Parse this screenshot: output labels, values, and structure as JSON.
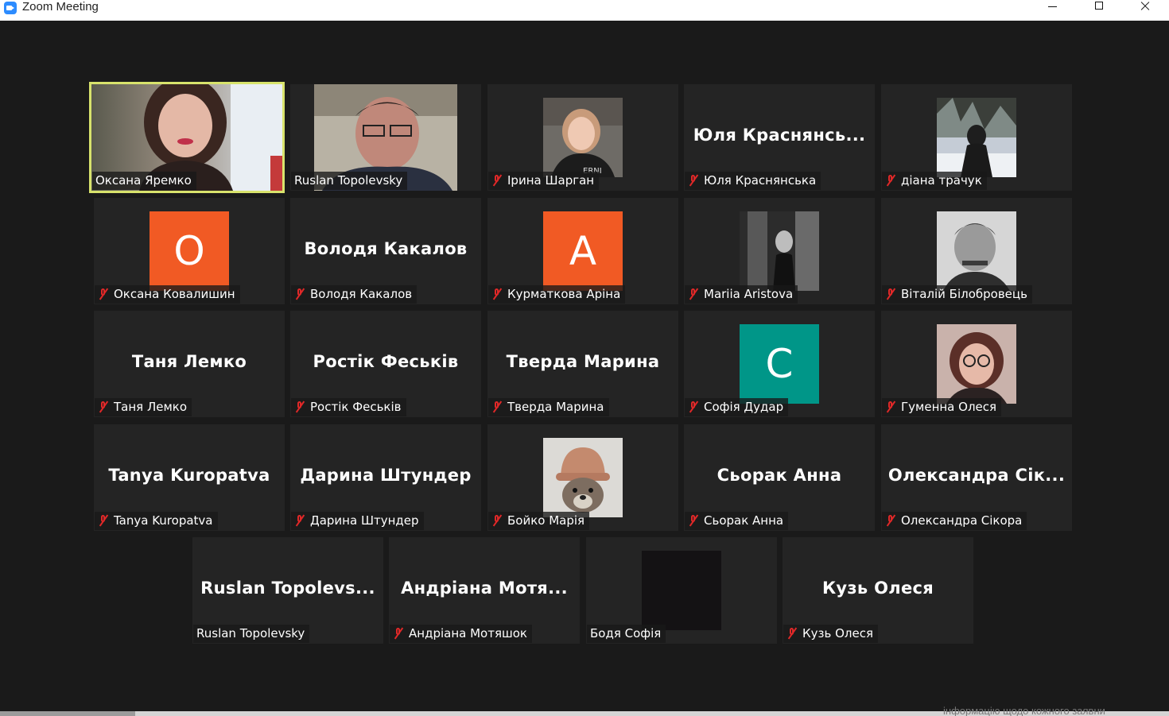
{
  "window": {
    "title": "Zoom Meeting",
    "controls": [
      "minimize",
      "maximize",
      "close"
    ]
  },
  "colors": {
    "active_speaker_border": "#d8e36c",
    "tile_bg": "#242424",
    "avatar_orange": "#f15a24",
    "avatar_teal": "#009688",
    "muted_icon": "#e02828"
  },
  "participants": [
    {
      "id": "p01",
      "label": "Оксана Яремко",
      "display": "video",
      "muted": false,
      "active": true
    },
    {
      "id": "p02",
      "label": "Ruslan Topolevsky",
      "display": "video",
      "muted": false
    },
    {
      "id": "p03",
      "label": "Ірина Шарган",
      "display": "photo",
      "muted": true
    },
    {
      "id": "p04",
      "label": "Юля Краснянська",
      "display": "name",
      "big": "Юля  Краснянсь...",
      "muted": true
    },
    {
      "id": "p05",
      "label": "діана трачук",
      "display": "photo",
      "muted": true
    },
    {
      "id": "p06",
      "label": "Оксана Ковалишин",
      "display": "initial",
      "initial": "O",
      "muted": true
    },
    {
      "id": "p07",
      "label": "Володя Какалов",
      "display": "name",
      "big": "Володя Какалов",
      "muted": true
    },
    {
      "id": "p08",
      "label": "Курматкова Аріна",
      "display": "initial",
      "initial": "A",
      "muted": true
    },
    {
      "id": "p09",
      "label": "Mariia Aristova",
      "display": "photo",
      "muted": true
    },
    {
      "id": "p10",
      "label": "Віталій Білобровець",
      "display": "photo",
      "muted": true
    },
    {
      "id": "p11",
      "label": "Таня Лемко",
      "display": "name",
      "big": "Таня Лемко",
      "muted": true
    },
    {
      "id": "p12",
      "label": "Ростік Феськів",
      "display": "name",
      "big": "Ростік Феськів",
      "muted": true
    },
    {
      "id": "p13",
      "label": "Тверда Марина",
      "display": "name",
      "big": "Тверда Марина",
      "muted": true
    },
    {
      "id": "p14",
      "label": "Софія Дудар",
      "display": "initial",
      "initial": "C",
      "muted": true
    },
    {
      "id": "p15",
      "label": "Гуменна Олеся",
      "display": "photo",
      "muted": true
    },
    {
      "id": "p16",
      "label": "Tanya Kuropatva",
      "display": "name",
      "big": "Tanya Kuropatva",
      "muted": true
    },
    {
      "id": "p17",
      "label": "Дарина Штундер",
      "display": "name",
      "big": "Дарина Штундер",
      "muted": true
    },
    {
      "id": "p18",
      "label": "Бойко Марія",
      "display": "photo",
      "muted": true
    },
    {
      "id": "p19",
      "label": "Сьорак Анна",
      "display": "name",
      "big": "Сьорак Анна",
      "muted": true
    },
    {
      "id": "p20",
      "label": "Олександра Сікора",
      "display": "name",
      "big": "Олександра  Сік...",
      "muted": true
    },
    {
      "id": "p21",
      "label": "Ruslan Topolevsky",
      "display": "name",
      "big": "Ruslan  Topolevs...",
      "muted": false
    },
    {
      "id": "p22",
      "label": "Андріана Мотяшок",
      "display": "name",
      "big": "Андріана  Мотя...",
      "muted": true
    },
    {
      "id": "p23",
      "label": "Бодя Софія",
      "display": "dark",
      "muted": false
    },
    {
      "id": "p24",
      "label": "Кузь Олеся",
      "display": "name",
      "big": "Кузь Олеся",
      "muted": true
    }
  ],
  "footer": {
    "background_peek_text": "інформацію щодо кожного заявни"
  }
}
